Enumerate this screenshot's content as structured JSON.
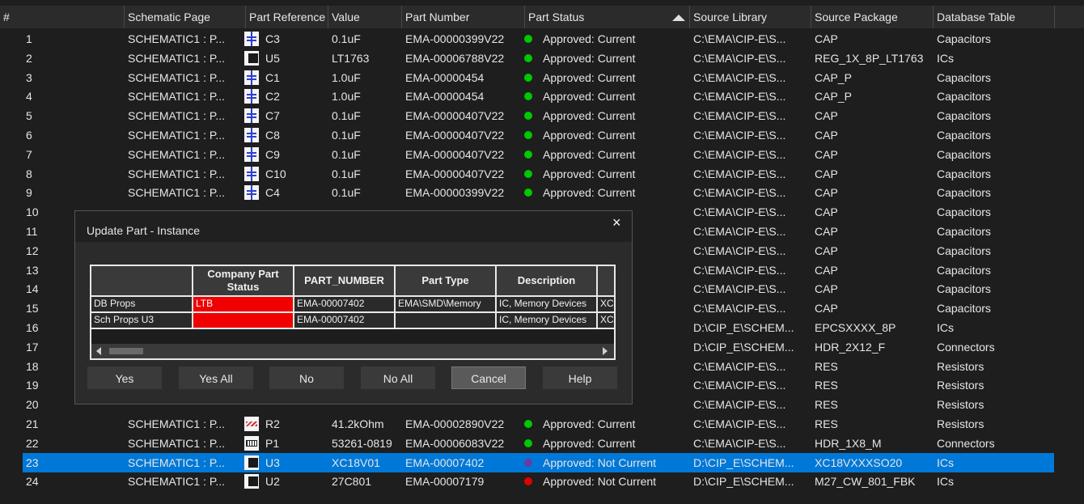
{
  "columns": [
    "#",
    "Schematic Page",
    "Part Reference",
    "Value",
    "Part Number",
    "Part Status",
    "Source Library",
    "Source Package",
    "Database Table"
  ],
  "rows": [
    {
      "num": "1",
      "page": "SCHEMATIC1 : P...",
      "icon": "cap",
      "ref": "C3",
      "value": "0.1uF",
      "pn": "EMA-00000399V22",
      "status": "Approved: Current",
      "statusColor": "#00c800",
      "lib": "C:\\EMA\\CIP-E\\S...",
      "pkg": "CAP",
      "table": "Capacitors"
    },
    {
      "num": "2",
      "page": "SCHEMATIC1 : P...",
      "icon": "ic",
      "ref": "U5",
      "value": "LT1763",
      "pn": "EMA-00006788V22",
      "status": "Approved: Current",
      "statusColor": "#00c800",
      "lib": "C:\\EMA\\CIP-E\\S...",
      "pkg": "REG_1X_8P_LT1763",
      "table": "ICs"
    },
    {
      "num": "3",
      "page": "SCHEMATIC1 : P...",
      "icon": "cap",
      "ref": "C1",
      "value": "1.0uF",
      "pn": "EMA-00000454",
      "status": "Approved: Current",
      "statusColor": "#00c800",
      "lib": "C:\\EMA\\CIP-E\\S...",
      "pkg": "CAP_P",
      "table": "Capacitors"
    },
    {
      "num": "4",
      "page": "SCHEMATIC1 : P...",
      "icon": "cap",
      "ref": "C2",
      "value": "1.0uF",
      "pn": "EMA-00000454",
      "status": "Approved: Current",
      "statusColor": "#00c800",
      "lib": "C:\\EMA\\CIP-E\\S...",
      "pkg": "CAP_P",
      "table": "Capacitors"
    },
    {
      "num": "5",
      "page": "SCHEMATIC1 : P...",
      "icon": "cap",
      "ref": "C7",
      "value": "0.1uF",
      "pn": "EMA-00000407V22",
      "status": "Approved: Current",
      "statusColor": "#00c800",
      "lib": "C:\\EMA\\CIP-E\\S...",
      "pkg": "CAP",
      "table": "Capacitors"
    },
    {
      "num": "6",
      "page": "SCHEMATIC1 : P...",
      "icon": "cap",
      "ref": "C8",
      "value": "0.1uF",
      "pn": "EMA-00000407V22",
      "status": "Approved: Current",
      "statusColor": "#00c800",
      "lib": "C:\\EMA\\CIP-E\\S...",
      "pkg": "CAP",
      "table": "Capacitors"
    },
    {
      "num": "7",
      "page": "SCHEMATIC1 : P...",
      "icon": "cap",
      "ref": "C9",
      "value": "0.1uF",
      "pn": "EMA-00000407V22",
      "status": "Approved: Current",
      "statusColor": "#00c800",
      "lib": "C:\\EMA\\CIP-E\\S...",
      "pkg": "CAP",
      "table": "Capacitors"
    },
    {
      "num": "8",
      "page": "SCHEMATIC1 : P...",
      "icon": "cap",
      "ref": "C10",
      "value": "0.1uF",
      "pn": "EMA-00000407V22",
      "status": "Approved: Current",
      "statusColor": "#00c800",
      "lib": "C:\\EMA\\CIP-E\\S...",
      "pkg": "CAP",
      "table": "Capacitors"
    },
    {
      "num": "9",
      "page": "SCHEMATIC1 : P...",
      "icon": "cap",
      "ref": "C4",
      "value": "0.1uF",
      "pn": "EMA-00000399V22",
      "status": "Approved: Current",
      "statusColor": "#00c800",
      "lib": "C:\\EMA\\CIP-E\\S...",
      "pkg": "CAP",
      "table": "Capacitors"
    },
    {
      "num": "10",
      "page": "",
      "icon": "",
      "ref": "",
      "value": "",
      "pn": "",
      "status": "",
      "statusColor": "",
      "lib": "C:\\EMA\\CIP-E\\S...",
      "pkg": "CAP",
      "table": "Capacitors"
    },
    {
      "num": "11",
      "page": "",
      "icon": "",
      "ref": "",
      "value": "",
      "pn": "",
      "status": "",
      "statusColor": "",
      "lib": "C:\\EMA\\CIP-E\\S...",
      "pkg": "CAP",
      "table": "Capacitors"
    },
    {
      "num": "12",
      "page": "",
      "icon": "",
      "ref": "",
      "value": "",
      "pn": "",
      "status": "",
      "statusColor": "",
      "lib": "C:\\EMA\\CIP-E\\S...",
      "pkg": "CAP",
      "table": "Capacitors"
    },
    {
      "num": "13",
      "page": "",
      "icon": "",
      "ref": "",
      "value": "",
      "pn": "",
      "status": "",
      "statusColor": "",
      "lib": "C:\\EMA\\CIP-E\\S...",
      "pkg": "CAP",
      "table": "Capacitors"
    },
    {
      "num": "14",
      "page": "",
      "icon": "",
      "ref": "",
      "value": "",
      "pn": "",
      "status": "",
      "statusColor": "",
      "lib": "C:\\EMA\\CIP-E\\S...",
      "pkg": "CAP",
      "table": "Capacitors"
    },
    {
      "num": "15",
      "page": "",
      "icon": "",
      "ref": "",
      "value": "",
      "pn": "",
      "status": "",
      "statusColor": "",
      "lib": "C:\\EMA\\CIP-E\\S...",
      "pkg": "CAP",
      "table": "Capacitors"
    },
    {
      "num": "16",
      "page": "",
      "icon": "",
      "ref": "",
      "value": "",
      "pn": "",
      "status": "",
      "statusColor": "",
      "lib": "D:\\CIP_E\\SCHEM...",
      "pkg": "EPCSXXXX_8P",
      "table": "ICs"
    },
    {
      "num": "17",
      "page": "",
      "icon": "",
      "ref": "",
      "value": "",
      "pn": "",
      "status": "",
      "statusColor": "",
      "lib": "D:\\CIP_E\\SCHEM...",
      "pkg": "HDR_2X12_F",
      "table": "Connectors"
    },
    {
      "num": "18",
      "page": "",
      "icon": "",
      "ref": "",
      "value": "",
      "pn": "",
      "status": "",
      "statusColor": "",
      "lib": "C:\\EMA\\CIP-E\\S...",
      "pkg": "RES",
      "table": "Resistors"
    },
    {
      "num": "19",
      "page": "",
      "icon": "",
      "ref": "",
      "value": "",
      "pn": "",
      "status": "",
      "statusColor": "",
      "lib": "C:\\EMA\\CIP-E\\S...",
      "pkg": "RES",
      "table": "Resistors"
    },
    {
      "num": "20",
      "page": "",
      "icon": "",
      "ref": "",
      "value": "",
      "pn": "",
      "status": "",
      "statusColor": "",
      "lib": "C:\\EMA\\CIP-E\\S...",
      "pkg": "RES",
      "table": "Resistors"
    },
    {
      "num": "21",
      "page": "SCHEMATIC1 : P...",
      "icon": "res",
      "ref": "R2",
      "value": "41.2kOhm",
      "pn": "EMA-00002890V22",
      "status": "Approved: Current",
      "statusColor": "#00c800",
      "lib": "C:\\EMA\\CIP-E\\S...",
      "pkg": "RES",
      "table": "Resistors"
    },
    {
      "num": "22",
      "page": "SCHEMATIC1 : P...",
      "icon": "con",
      "ref": "P1",
      "value": "53261-0819",
      "pn": "EMA-00006083V22",
      "status": "Approved: Current",
      "statusColor": "#00c800",
      "lib": "C:\\EMA\\CIP-E\\S...",
      "pkg": "HDR_1X8_M",
      "table": "Connectors"
    },
    {
      "num": "23",
      "page": "SCHEMATIC1 : P...",
      "icon": "ic",
      "ref": "U3",
      "value": "XC18V01",
      "pn": "EMA-00007402",
      "status": "Approved: Not Current",
      "statusColor": "#6a3aa8",
      "lib": "D:\\CIP_E\\SCHEM...",
      "pkg": "XC18VXXXSO20",
      "table": "ICs",
      "selected": true
    },
    {
      "num": "24",
      "page": "SCHEMATIC1 : P...",
      "icon": "ic",
      "ref": "U2",
      "value": "27C801",
      "pn": "EMA-00007179",
      "status": "Approved: Not Current",
      "statusColor": "#e00000",
      "lib": "D:\\CIP_E\\SCHEM...",
      "pkg": "M27_CW_801_FBK",
      "table": "ICs"
    }
  ],
  "dialog": {
    "title": "Update Part - Instance",
    "close": "×",
    "headers": [
      "",
      "Company Part Status",
      "PART_NUMBER",
      "Part Type",
      "Description",
      ""
    ],
    "rows": [
      {
        "label": "DB Props",
        "status": "LTB",
        "pn": "EMA-00007402",
        "type": "EMA\\SMD\\Memory",
        "desc": "IC, Memory Devices",
        "extra": "XC"
      },
      {
        "label": "Sch Props U3",
        "status": "",
        "pn": "EMA-00007402",
        "type": "",
        "desc": "IC, Memory Devices",
        "extra": "XC"
      }
    ],
    "buttons": [
      "Yes",
      "Yes All",
      "No",
      "No All",
      "Cancel",
      "Help"
    ]
  },
  "colors": {
    "conflict": "#f00000",
    "selection": "#0078d7",
    "approved": "#00c800"
  }
}
